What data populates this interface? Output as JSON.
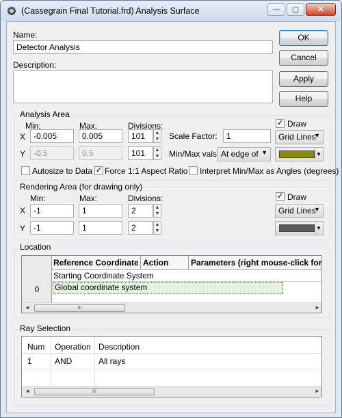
{
  "window": {
    "title": "(Cassegrain Final Tutorial.frd) Analysis Surface",
    "controls": {
      "minimize": "—",
      "maximize": "▢",
      "close": "✕"
    }
  },
  "name": {
    "label": "Name:",
    "value": "Detector Analysis"
  },
  "description": {
    "label": "Description:",
    "value": ""
  },
  "buttons": {
    "ok": "OK",
    "cancel": "Cancel",
    "apply": "Apply",
    "help": "Help"
  },
  "analysis_area": {
    "title": "Analysis Area",
    "min_label": "Min:",
    "max_label": "Max:",
    "div_label": "Divisions:",
    "x": {
      "axis": "X",
      "min": "-0.005",
      "max": "0.005",
      "div": "101"
    },
    "y": {
      "axis": "Y",
      "min": "-0.5",
      "max": "0.5",
      "div": "101"
    },
    "scale_label": "Scale Factor:",
    "scale_value": "1",
    "minmax_label": "Min/Max vals:",
    "minmax_value": "At edge of",
    "draw_label": "Draw",
    "grid_mode": "Grid Lines",
    "color": "#8c8a00",
    "autosize_label": "Autosize to Data",
    "force_label": "Force 1:1 Aspect Ratio",
    "interpret_label": "Interpret Min/Max as Angles (degrees)"
  },
  "rendering_area": {
    "title": "Rendering Area (for drawing only)",
    "min_label": "Min:",
    "max_label": "Max:",
    "div_label": "Divisions:",
    "x": {
      "axis": "X",
      "min": "-1",
      "max": "1",
      "div": "2"
    },
    "y": {
      "axis": "Y",
      "min": "-1",
      "max": "1",
      "div": "2"
    },
    "draw_label": "Draw",
    "grid_mode": "Grid Lines",
    "color": "#5a5a5a"
  },
  "location": {
    "title": "Location",
    "headers": [
      "Reference Coordinate",
      "Action",
      "Parameters (right mouse-click for"
    ],
    "rows": [
      {
        "num": "",
        "ref": "Starting Coordinate System"
      },
      {
        "num": "0",
        "ref": "Global coordinate system"
      }
    ]
  },
  "ray_selection": {
    "title": "Ray Selection",
    "headers": [
      "Num",
      "Operation",
      "Description"
    ],
    "rows": [
      {
        "num": "1",
        "op": "AND",
        "desc": "All rays"
      }
    ]
  },
  "scroll": {
    "grip": "III",
    "left": "◄",
    "right": "►"
  },
  "glyphs": {
    "check": "✓",
    "up": "▲",
    "down": "▼"
  }
}
